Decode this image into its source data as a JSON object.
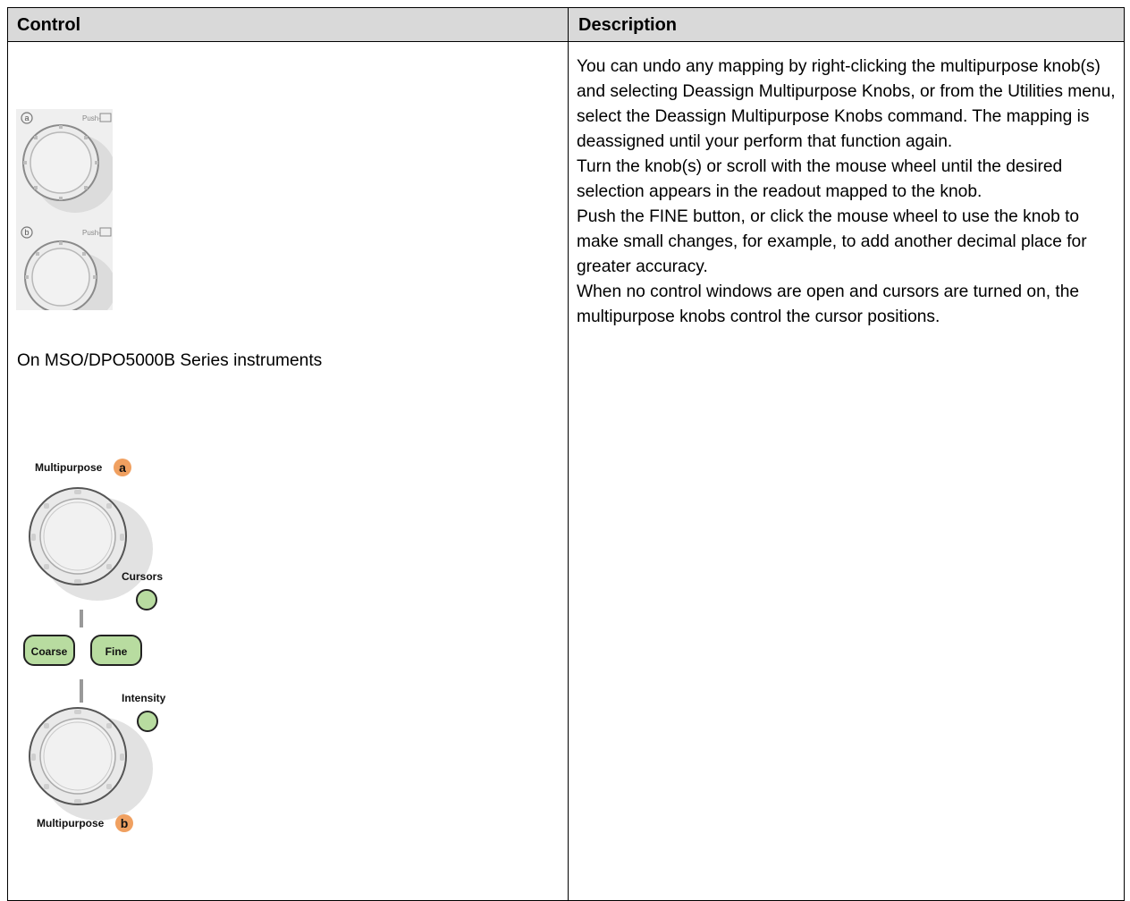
{
  "table": {
    "headers": {
      "control": "Control",
      "description": "Description"
    },
    "control_note": "On MSO/DPO5000B Series instruments",
    "description_paragraphs": [
      "You can undo any mapping by right-clicking the multipurpose knob(s) and selecting Deassign Multipurpose Knobs, or from the Utilities menu, select the Deassign Multipurpose Knobs command. The mapping is deassigned until your perform that function again.",
      "Turn the knob(s) or scroll with the mouse wheel until the desired selection appears in the readout mapped to the knob.",
      "Push the FINE button, or click the mouse wheel to use the knob to make small changes, for example, to add another decimal place for greater accuracy.",
      "When no control windows are open and cursors are turned on, the multipurpose knobs control the cursor positions."
    ]
  },
  "panel_small": {
    "knob_a_badge": "a",
    "knob_b_badge": "b",
    "push_label": "Push-"
  },
  "panel_large": {
    "label_top": "Multipurpose",
    "badge_top": "a",
    "cursors": "Cursors",
    "coarse": "Coarse",
    "fine": "Fine",
    "intensity": "Intensity",
    "label_bottom": "Multipurpose",
    "badge_bottom": "b"
  },
  "colors": {
    "header_bg": "#d9d9d9",
    "badge_orange": "#f0a060",
    "button_green": "#b8dca0",
    "knob_gray": "#e6e6e6"
  }
}
